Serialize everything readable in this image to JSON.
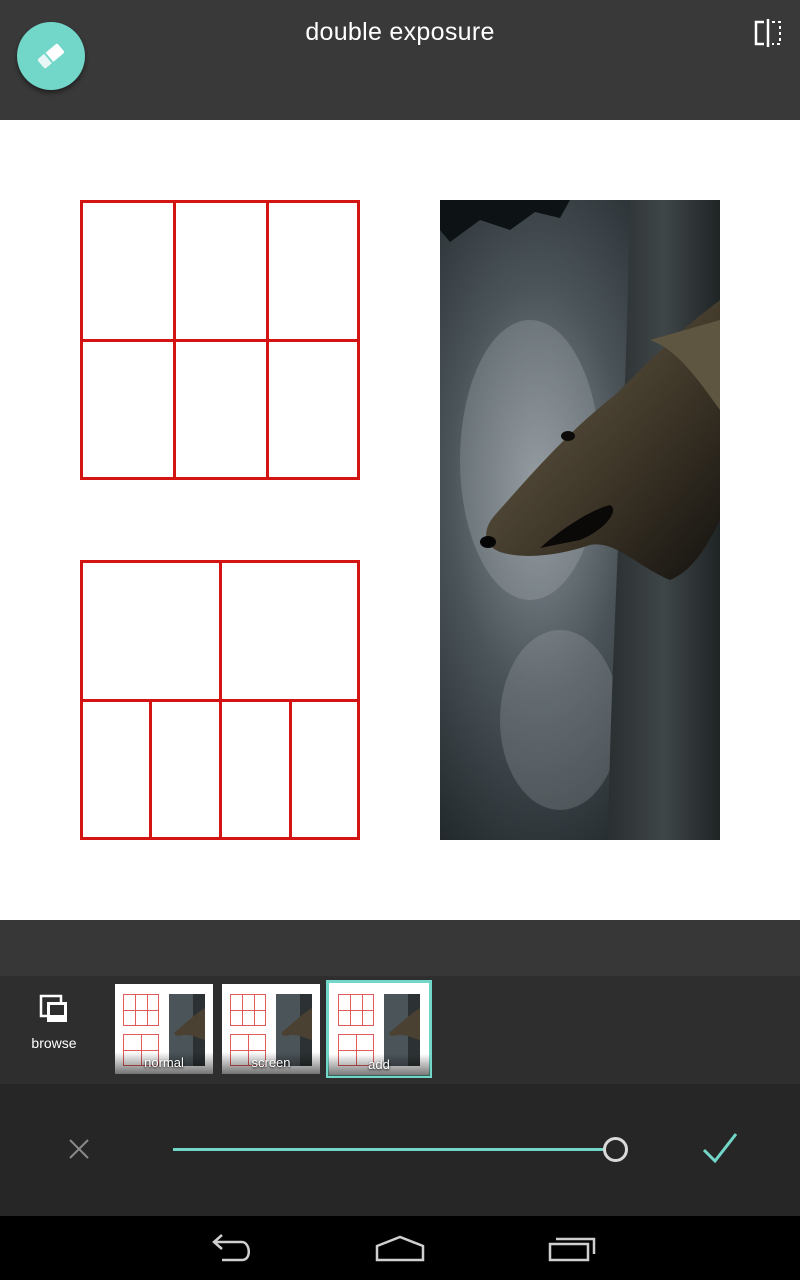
{
  "header": {
    "title": "double exposure",
    "eraser_icon": "eraser-icon",
    "compare_icon": "compare-split-icon"
  },
  "blend": {
    "browse_label": "browse",
    "browse_icon": "stacked-photos-icon",
    "modes": [
      {
        "label": "normal",
        "selected": false
      },
      {
        "label": "screen",
        "selected": false
      },
      {
        "label": "add",
        "selected": true
      }
    ]
  },
  "slider": {
    "value_fraction": 1.0,
    "cancel_icon": "close-icon",
    "confirm_icon": "checkmark-icon"
  },
  "nav": {
    "back_icon": "back-icon",
    "home_icon": "home-icon",
    "recents_icon": "recents-icon"
  },
  "colors": {
    "accent": "#72d6c9",
    "grid_red": "#d41313",
    "toolbar": "#393939"
  }
}
